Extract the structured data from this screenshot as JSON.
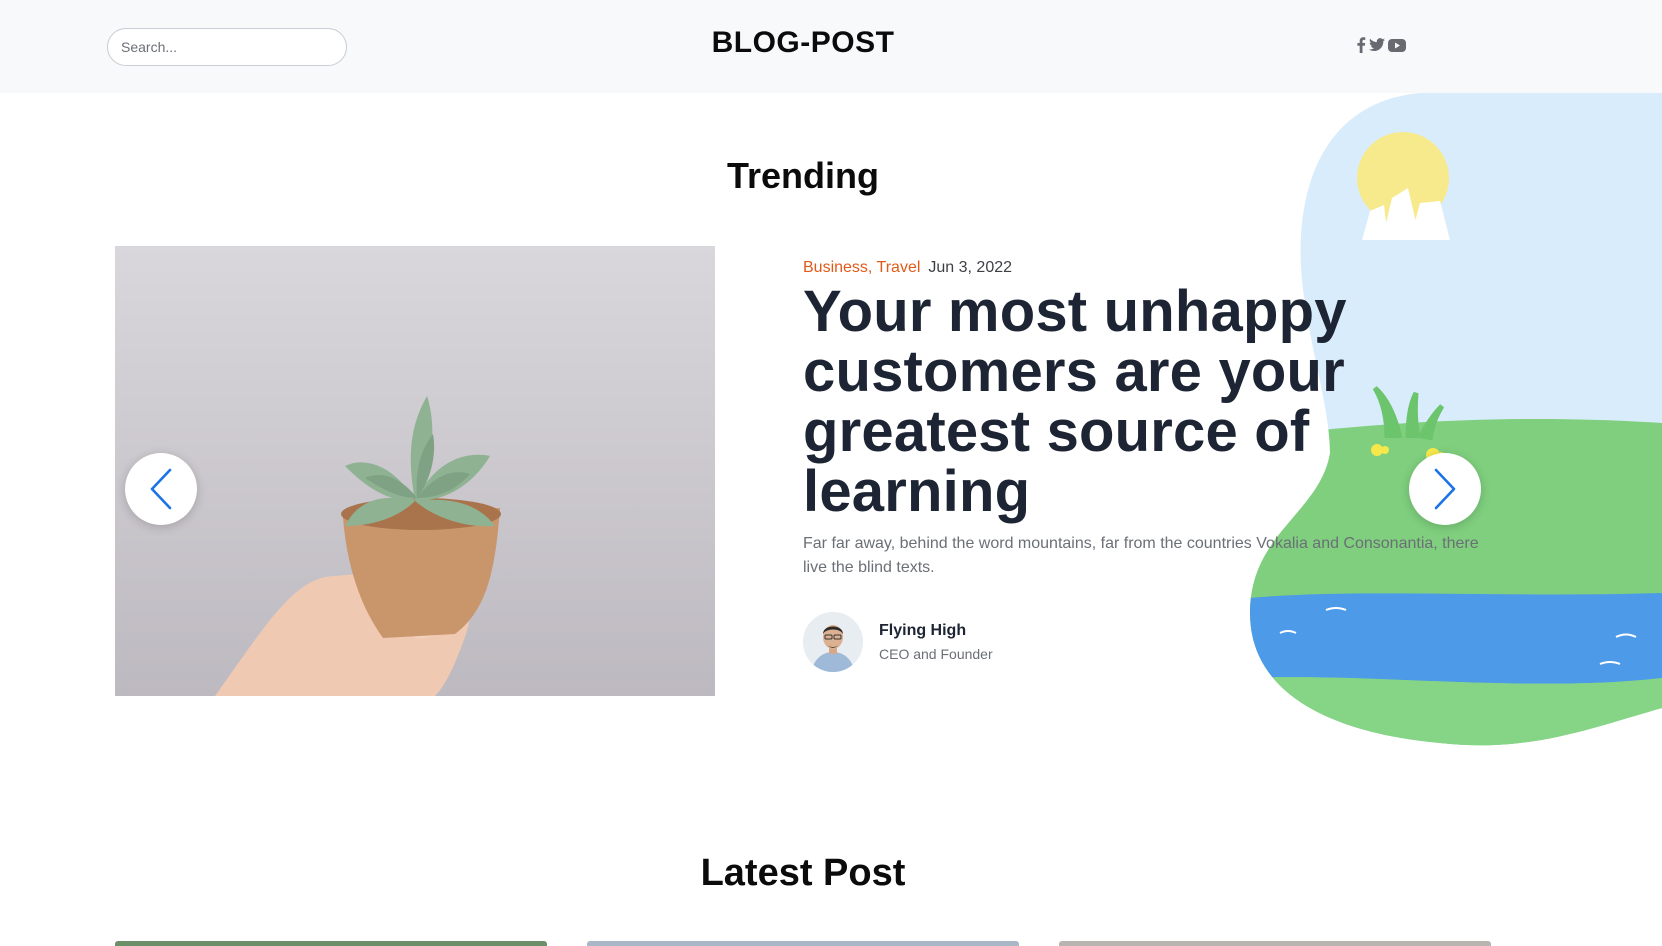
{
  "header": {
    "logo": "BLOG-POST",
    "search": {
      "placeholder": "Search...",
      "value": ""
    },
    "social": [
      "facebook-icon",
      "twitter-icon",
      "youtube-icon"
    ]
  },
  "trending": {
    "section_title": "Trending",
    "post": {
      "categories": [
        "Business",
        "Travel"
      ],
      "category_separator": ",",
      "date": "Jun 3, 2022",
      "title": "Your most unhappy customers are your greatest source of learning",
      "excerpt": "Far far away, behind the word mountains, far from the countries Vokalia and Consonantia, there live the blind texts.",
      "author": {
        "name": "Flying High",
        "role": "CEO and Founder"
      }
    },
    "controls": {
      "prev": "chevron-left-icon",
      "next": "chevron-right-icon"
    }
  },
  "latest": {
    "section_title": "Latest Post"
  },
  "colors": {
    "accent": "#e05b1a",
    "title": "#1d2433",
    "header_bg": "#f8f9fb",
    "nav_arrow": "#1a73e8",
    "sky": "#d8ecfb",
    "grass": "#7fcf7e",
    "water": "#4d9ae8"
  }
}
